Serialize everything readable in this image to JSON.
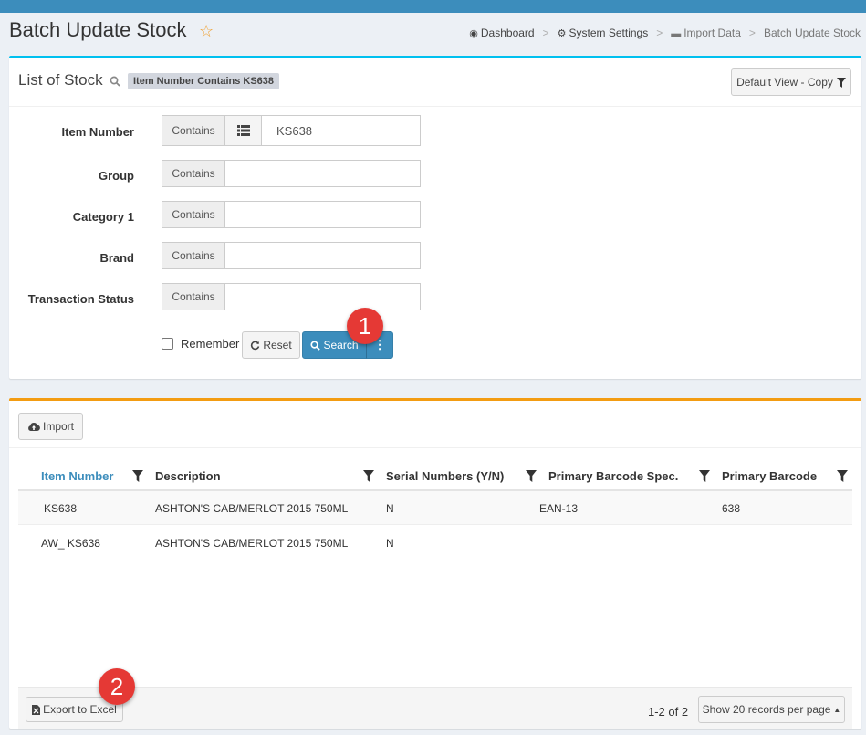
{
  "header": {
    "title": "Batch Update Stock",
    "breadcrumb": [
      "Dashboard",
      "System Settings",
      "Import Data",
      "Batch Update Stock"
    ]
  },
  "filter_panel": {
    "title": "List of Stock",
    "active_filter": "Item Number Contains  KS638",
    "view_button": "Default View - Copy",
    "fields": [
      {
        "label": "Item Number",
        "operator": "Contains",
        "value": "KS638"
      },
      {
        "label": "Group",
        "operator": "Contains",
        "value": ""
      },
      {
        "label": "Category 1",
        "operator": "Contains",
        "value": ""
      },
      {
        "label": "Brand",
        "operator": "Contains",
        "value": ""
      },
      {
        "label": "Transaction Status",
        "operator": "Contains",
        "value": ""
      }
    ],
    "remember_label": "Remember",
    "reset_label": "Reset",
    "search_label": "Search"
  },
  "results_panel": {
    "import_label": "Import",
    "columns": [
      "Item Number",
      "Description",
      "Serial Numbers (Y/N)",
      "Primary Barcode Spec.",
      "Primary Barcode"
    ],
    "rows": [
      [
        "KS638",
        "ASHTON'S CAB/MERLOT 2015 750ML",
        "N",
        "EAN-13",
        "638"
      ],
      [
        "AW_ KS638",
        "ASHTON'S CAB/MERLOT 2015 750ML",
        "N",
        "",
        ""
      ]
    ],
    "export_label": "Export to Excel",
    "page_count": "1-2 of 2",
    "per_page_label": "Show 20 records per page"
  },
  "markers": [
    "1",
    "2"
  ],
  "colors": {
    "primary": "#3c8dbc",
    "info_border": "#00c0ef",
    "warning_border": "#f39c12",
    "marker": "#e53935"
  }
}
